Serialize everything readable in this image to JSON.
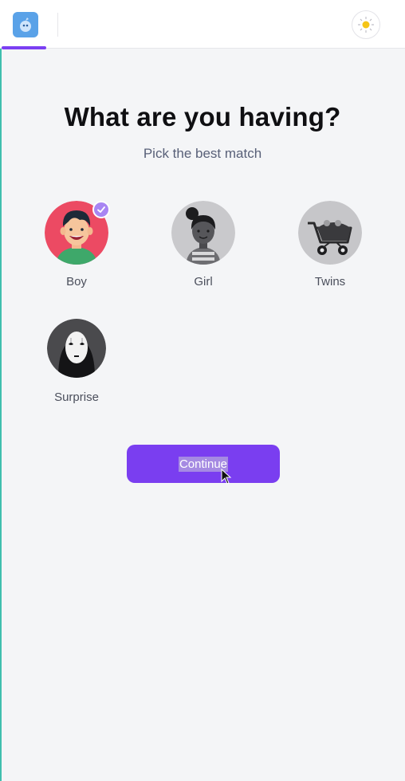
{
  "header": {
    "logo_icon": "app-logo-icon",
    "theme_icon": "sun-icon",
    "accent_color": "#7b3ff2"
  },
  "main": {
    "title": "What are you having?",
    "subtitle": "Pick the best match",
    "options": [
      {
        "label": "Boy",
        "icon": "boy-avatar-icon",
        "selected": true
      },
      {
        "label": "Girl",
        "icon": "girl-avatar-icon",
        "selected": false
      },
      {
        "label": "Twins",
        "icon": "stroller-icon",
        "selected": false
      },
      {
        "label": "Surprise",
        "icon": "mask-icon",
        "selected": false
      }
    ],
    "continue_label": "Continue"
  }
}
